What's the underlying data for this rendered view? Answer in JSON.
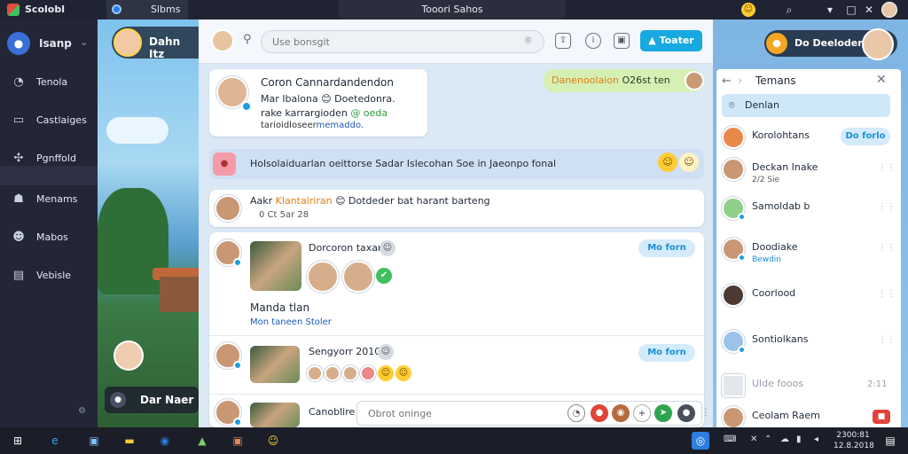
{
  "window": {
    "app_name": "Scolobl",
    "tab_label": "Slbms",
    "center_title": "Tooori Sahos",
    "controls": [
      "emoji-icon",
      "pin-icon",
      "minimize-icon",
      "restore-icon",
      "close-icon",
      "user-avatar"
    ]
  },
  "sidebar": {
    "brand": "Isanp",
    "items": [
      {
        "label": "Tenola",
        "icon": "clock-icon"
      },
      {
        "label": "Castlaiges",
        "icon": "folder-icon"
      },
      {
        "label": "Pgnffold",
        "icon": "puzzle-icon"
      },
      {
        "label": "Menams",
        "icon": "people-icon"
      },
      {
        "label": "Mabos",
        "icon": "smile-icon"
      },
      {
        "label": "Vebisle",
        "icon": "chat-icon"
      }
    ]
  },
  "scene": {
    "header_name": "Dahn Itz",
    "footer_name": "Dar Naer"
  },
  "toolbar": {
    "search_placeholder": "Use bonsgit",
    "share_label": "Toater"
  },
  "messages": {
    "msg1": {
      "title": "Coron Cannardandendon",
      "line2": "Mar Ibalona 😊 Doetedonra.",
      "line3_pre": "rake karrargioden",
      "line3_post": "@ oeda",
      "line4_pre": "tarioidloseer",
      "line4_link": "memaddo."
    },
    "pill": {
      "highlight": "Danenoolaion",
      "text": "O26st ten"
    },
    "banner": "Holsolaiduarlan oeittorse Sadar Islecohan Soe in Jaeonpo fonal",
    "msg2": {
      "name": "Aakr",
      "highlight": "Klantairiran",
      "rest": "😊 Dotdeder bat harant barteng",
      "sub": "0 Ct 5ar 28"
    }
  },
  "feed": {
    "posts": [
      {
        "title": "Dorcoron taxan",
        "follow": "Mo forn"
      },
      {
        "title": "Sengyorr 2010",
        "follow": "Mo forn"
      },
      {
        "title": "Canoblire",
        "follow": ""
      }
    ],
    "caption_title": "Manda tlan",
    "caption_sub": "Mon taneen Stoler"
  },
  "composer": {
    "placeholder": "Obrot oninge"
  },
  "right_panel": {
    "header_name": "Do Deeloder",
    "title": "Temans",
    "search": "Denlan",
    "contacts": [
      {
        "name": "Korolohtans",
        "sub": "",
        "button": "Do forlo"
      },
      {
        "name": "Deckan Inake",
        "sub": "2/2 Sie",
        "button": ""
      },
      {
        "name": "Samoldab b",
        "sub": "",
        "button": ""
      },
      {
        "name": "Doodiake",
        "sub": "Bewdin",
        "button": ""
      },
      {
        "name": "Coorlood",
        "sub": "",
        "button": ""
      },
      {
        "name": "Sontiolkans",
        "sub": "",
        "button": ""
      },
      {
        "name": "Ulde fooos",
        "sub": "",
        "button": ""
      },
      {
        "name": "Ceolam Raem",
        "sub": "",
        "button": ""
      }
    ],
    "time_label": "2:11"
  },
  "taskbar": {
    "clock_time": "2300:81",
    "clock_date": "12.8.2018"
  },
  "colors": {
    "accent": "#17a9e0",
    "sidebar_bg": "#232636",
    "titlebar_bg": "#202432",
    "pill_green": "#d6f0b4"
  }
}
